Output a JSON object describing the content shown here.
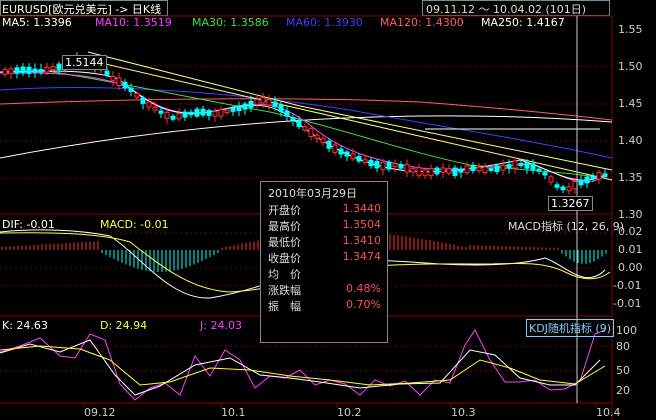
{
  "header": {
    "title": "EURUSD[欧元兑美元] -> 日K线",
    "date_range": "09.11.12 ～ 10.04.02 (101日)"
  },
  "ma": [
    {
      "label": "MA5: 1.3396",
      "color": "#ffffff"
    },
    {
      "label": "MA10: 1.3519",
      "color": "#ff40ff"
    },
    {
      "label": "MA30: 1.3586",
      "color": "#40e040"
    },
    {
      "label": "MA60: 1.3930",
      "color": "#4040ff"
    },
    {
      "label": "MA120: 1.4300",
      "color": "#ff6060"
    },
    {
      "label": "MA250: 1.4167",
      "color": "#ffffff"
    }
  ],
  "price_axis": [
    "1.55",
    "1.50",
    "1.45",
    "1.40",
    "1.35",
    "1.30"
  ],
  "price_annotations": {
    "high": "1.5144",
    "low": "1.3267"
  },
  "macd": {
    "dif": "DIF: -0.01",
    "macd": "MACD: -0.01",
    "title": "MACD指标 (12, 26, 9)",
    "axis": [
      "0.02",
      "0.01",
      "0.00",
      "-0.01",
      "-0.01"
    ]
  },
  "kdj": {
    "k": "K: 24.63",
    "d": "D: 24.94",
    "j": "J: 24.03",
    "title": "KDJ随机指标 (9)",
    "axis": [
      "100",
      "80",
      "50",
      "20"
    ]
  },
  "x_axis": [
    "09.12",
    "10.1",
    "10.2",
    "10.3",
    "10.4"
  ],
  "tooltip": {
    "date": "2010年03月29日",
    "rows": [
      {
        "label": "开盘价",
        "value": "1.3440"
      },
      {
        "label": "最高价",
        "value": "1.3504"
      },
      {
        "label": "最低价",
        "value": "1.3410"
      },
      {
        "label": "收盘价",
        "value": "1.3474"
      },
      {
        "label": "均　价",
        "value": ""
      },
      {
        "label": "涨跌幅",
        "value": "0.48%"
      },
      {
        "label": "振　幅",
        "value": "0.70%"
      }
    ]
  },
  "colors": {
    "up": "#ff3030",
    "down": "#00ffff",
    "grid": "#8b0000"
  }
}
